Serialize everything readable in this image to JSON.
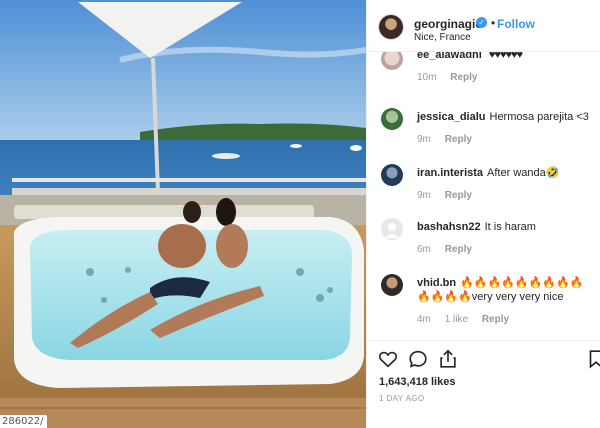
{
  "photo": {
    "id_label": "286022/"
  },
  "header": {
    "username": "georginagio",
    "verified_mark": "✓",
    "separator": "•",
    "follow_label": "Follow",
    "location": "Nice, France"
  },
  "comments": [
    {
      "username": "ee_alawadhi",
      "text": "",
      "time": "10m",
      "likes": "",
      "reply": "Reply"
    },
    {
      "username": "jessica_dialu",
      "text": "Hermosa parejita <3",
      "time": "9m",
      "likes": "",
      "reply": "Reply"
    },
    {
      "username": "iran.interista",
      "text": "After wanda🤣",
      "time": "9m",
      "likes": "",
      "reply": "Reply"
    },
    {
      "username": "bashahsn22",
      "text": "It is haram",
      "time": "6m",
      "likes": "",
      "reply": "Reply"
    },
    {
      "username": "vhid.bn",
      "text": "🔥🔥🔥🔥🔥🔥🔥🔥🔥🔥🔥🔥🔥very very very nice",
      "time": "4m",
      "likes": "1 like",
      "reply": "Reply"
    }
  ],
  "post": {
    "likes": "1,643,418 likes",
    "time_ago": "1 DAY AGO"
  },
  "icons": {
    "like": "heart-icon",
    "comment": "comment-icon",
    "share": "share-icon",
    "save": "bookmark-icon"
  }
}
